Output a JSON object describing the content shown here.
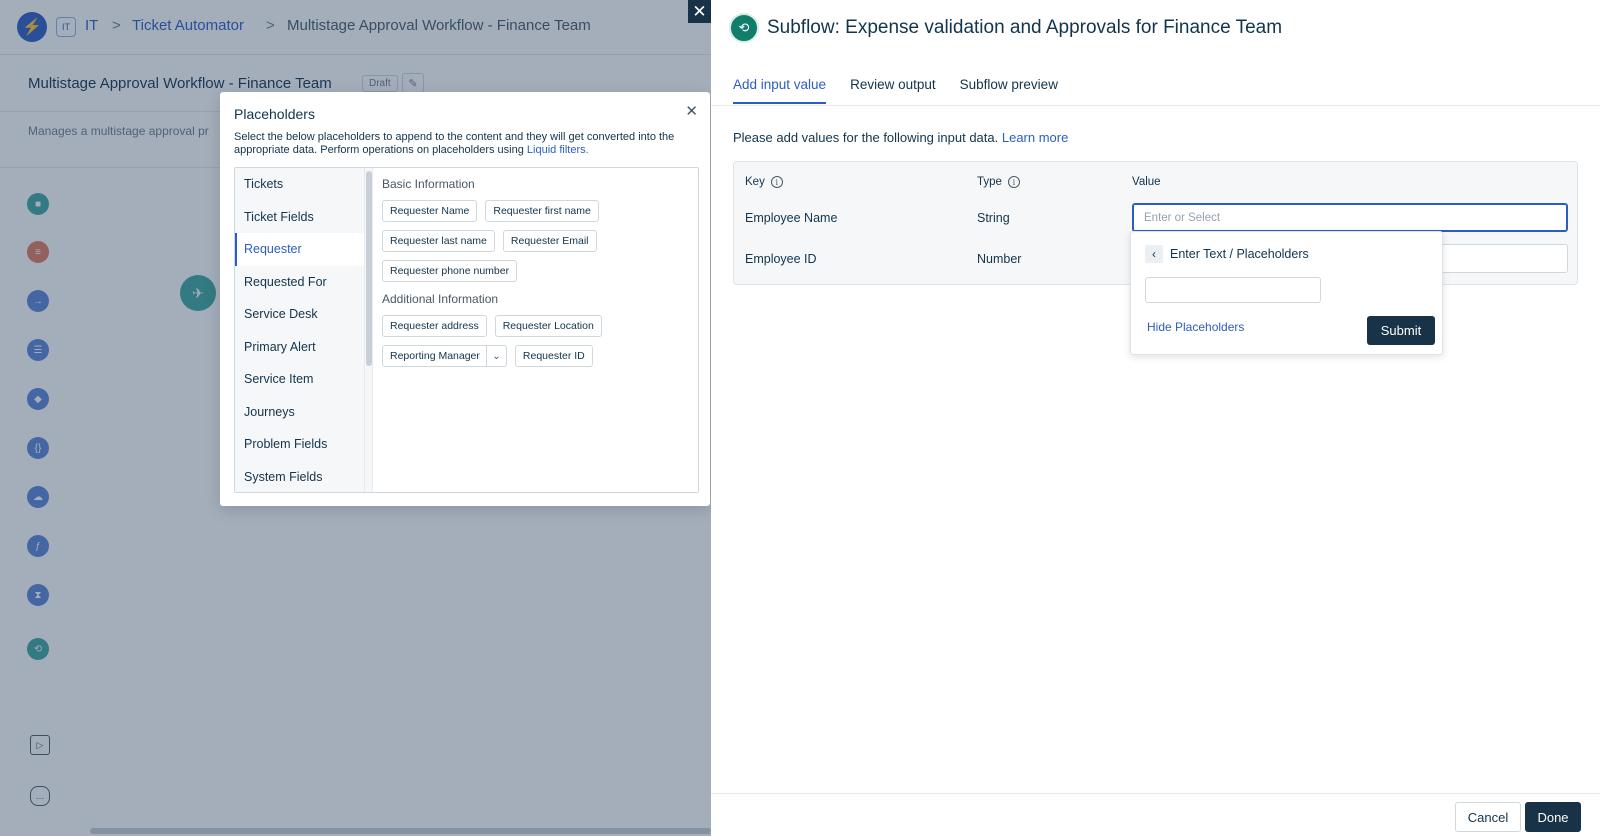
{
  "background": {
    "badge": "IT",
    "breadcrumbs": [
      "IT",
      "Ticket Automator",
      "Multistage Approval Workflow - Finance Team"
    ],
    "separator": ">",
    "header_title": "Multistage Approval Workflow - Finance Team",
    "draft_label": "Draft",
    "description": "Manages a multistage approval pr"
  },
  "placeholders_modal": {
    "title": "Placeholders",
    "description": "Select the below placeholders to append to the content and they will get converted into the appropriate data. Perform operations on placeholders using",
    "link": "Liquid filters.",
    "categories": [
      "Tickets",
      "Ticket Fields",
      "Requester",
      "Requested For",
      "Service Desk",
      "Primary Alert",
      "Service Item",
      "Journeys",
      "Problem Fields",
      "System Fields"
    ],
    "active_category": "Requester",
    "sections": [
      {
        "title": "Basic Information",
        "chips": [
          "Requester Name",
          "Requester first name",
          "Requester last name",
          "Requester Email",
          "Requester phone number"
        ]
      },
      {
        "title": "Additional Information",
        "chips": [
          "Requester address",
          "Requester Location",
          "Reporting Manager",
          "Requester ID"
        ]
      }
    ]
  },
  "drawer": {
    "title": "Subflow: Expense validation and Approvals for Finance Team",
    "tabs": [
      "Add input value",
      "Review output",
      "Subflow preview"
    ],
    "active_tab": "Add input value",
    "intro": "Please add values for the following input data.",
    "learn_more": "Learn more",
    "columns": {
      "key": "Key",
      "type": "Type",
      "value": "Value"
    },
    "rows": [
      {
        "key": "Employee Name",
        "type": "String",
        "value": "",
        "placeholder": "Enter or Select"
      },
      {
        "key": "Employee ID",
        "type": "Number",
        "value": "",
        "placeholder": ""
      }
    ],
    "popover": {
      "title": "Enter Text / Placeholders",
      "input_value": "",
      "hide_label": "Hide Placeholders",
      "submit_label": "Submit"
    },
    "footer": {
      "cancel_label": "Cancel",
      "done_label": "Done"
    }
  },
  "colors": {
    "accent": "#2c5cc5",
    "primary_button": "#183247",
    "subflow_icon": "#107e6b"
  }
}
